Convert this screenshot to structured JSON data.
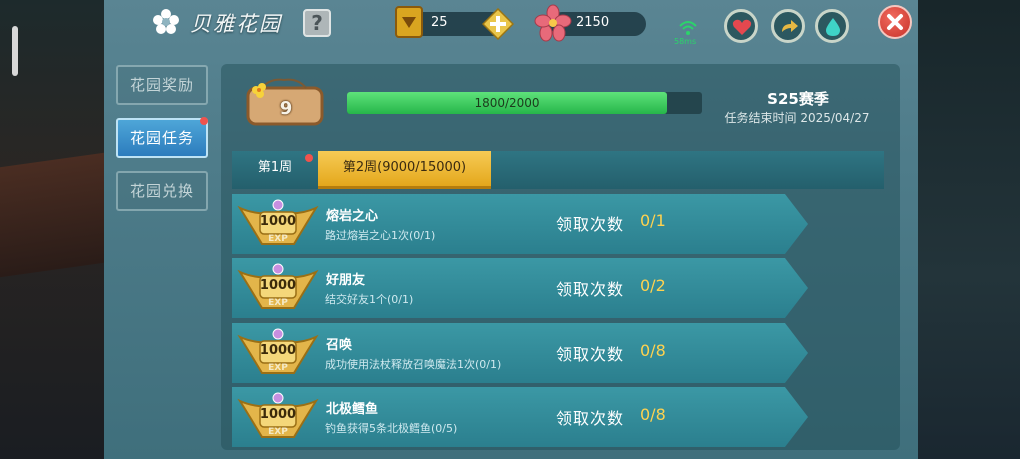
{
  "header": {
    "title": "贝雅花园",
    "help_label": "?",
    "gold_count": "25",
    "flower_currency": "2150",
    "ping": "58ms",
    "colors": {
      "accent_gold": "#e4a71c",
      "progress_green": "#26b64a",
      "active_blue": "#2c7cbd",
      "badge_red": "#f0534d"
    }
  },
  "sidebar": {
    "items": [
      {
        "label": "花园奖励"
      },
      {
        "label": "花园任务"
      },
      {
        "label": "花园兑换"
      }
    ]
  },
  "level": {
    "value": "9"
  },
  "progress": {
    "text": "1800/2000",
    "fraction": 0.9
  },
  "season": {
    "label": "S25赛季",
    "end_text": "任务结束时间 2025/04/27"
  },
  "tabs": [
    {
      "label": "第1周"
    },
    {
      "label": "第2周(9000/15000)"
    }
  ],
  "tasks": [
    {
      "reward": "1000",
      "reward_unit": "EXP",
      "title": "熔岩之心",
      "desc": "路过熔岩之心1次(0/1)",
      "claim_label": "领取次数",
      "claim_count": "0/1"
    },
    {
      "reward": "1000",
      "reward_unit": "EXP",
      "title": "好朋友",
      "desc": "结交好友1个(0/1)",
      "claim_label": "领取次数",
      "claim_count": "0/2"
    },
    {
      "reward": "1000",
      "reward_unit": "EXP",
      "title": "召唤",
      "desc": "成功使用法杖释放召唤魔法1次(0/1)",
      "claim_label": "领取次数",
      "claim_count": "0/8"
    },
    {
      "reward": "1000",
      "reward_unit": "EXP",
      "title": "北极鳕鱼",
      "desc": "钓鱼获得5条北极鳕鱼(0/5)",
      "claim_label": "领取次数",
      "claim_count": "0/8"
    }
  ]
}
